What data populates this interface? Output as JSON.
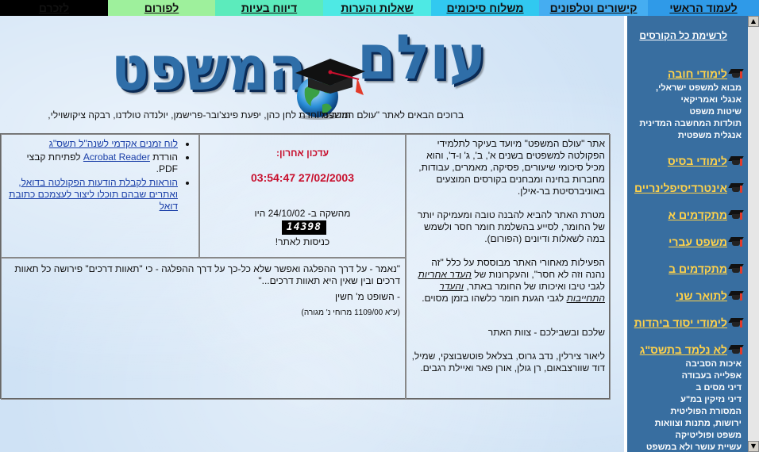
{
  "nav": {
    "zikhrono": "לזכרם",
    "forums": "לפורום",
    "reports": "דיווח בעיות",
    "qa": "שאלות והערות",
    "summaries": "משלוח סיכומים",
    "links": "קישורים וטלפונים",
    "home": "לעמוד הראשי"
  },
  "logo": {
    "word_right": "עולם",
    "word_left": "המשפט"
  },
  "welcome": "ברוכים הבאים לאתר \"עולם המשפט\"!",
  "thanks": "תודה מיוחדת לחן כהן, יפעת פינצ'ובר-פרישמן, יולנדה טולדנו, רבקה ציקושוילי,",
  "about": {
    "p1": "אתר \"עולם המשפט\" מיועד בעיקר לתלמידי הפקולטה למשפטים בשנים א', ב', ג' ו-ד', והוא מכיל סיכומי שיעורים, פסיקה, מאמרים, עבודות, מחברות בחינה ומבחנים בקורסים המוצעים באוניברסיטת בר-אילן.",
    "p2": "מטרת האתר להביא להבנה טובה ומעמיקה יותר של החומר, לסייע בהשלמת חומר חסר ולשמש במה לשאלות ודיונים (הפורום).",
    "p3a": "הפעילות מאחורי האתר מבוססת על כלל \"זה נהנה וזה לא חסר\", והעקרונות של",
    "p3b": "העדר אחריות",
    "p3c": "לגבי טיבו ואיכותו של החומר באתר,",
    "p3d": "והעדר התחייבות",
    "p3e": "לגבי הגעת חומר כלשהו בזמן מסוים.",
    "p4": "שלכם ובשבילכם - צוות האתר",
    "p5": "ליאור צירלין, נדב גרוס, בצלאל פוטשבוצקי, שמיל, דוד שוורצבאום, רן גולן, אורן פאר ואיילת רגבים."
  },
  "update": {
    "title": "עדכון אחרון:",
    "date": "03:54:47 27/02/2003",
    "relaunch": "מהשקה ב- 24/10/02 היו",
    "counter": "14398",
    "counter_label": "כניסות לאתר!"
  },
  "links": {
    "item1": "לוח זמנים אקדמי לשנה\"ל תשס\"ג",
    "item2_pre": "הורדת",
    "item2_link": "Acrobat Reader",
    "item2_post": "לפתיחת קבצי PDF.",
    "item3": "הוראות לקבלת הודעות הפקולטה בדואל, ואתרים שבהם תוכלו ליצור לעצמכם כתובת דואל"
  },
  "quote": {
    "text": "\"נאמר - על דרך ההפלגה ואפשר שלא כל-כך על דרך ההפלגה - כי \"תאוות דרכים\" פירושה כל תאוות דרכים ובין שאין היא תאוות דרכים...\"",
    "author": "- השופט מ' חשין",
    "source": "(ע\"א 1109/00 מרוחי נ' מגורה)"
  },
  "sidebar": {
    "course_list": "לרשימת כל הקורסים",
    "cats": [
      {
        "label": "לימודי חובה"
      },
      {
        "label": "לימודי בסיס"
      },
      {
        "label": "אינטרדיסיפלינריים"
      },
      {
        "label": "מתקדמים א"
      },
      {
        "label": "משפט עברי"
      },
      {
        "label": "מתקדמים ב"
      },
      {
        "label": "לתואר שני"
      },
      {
        "label": "לימודי יסוד ביהדות"
      },
      {
        "label": "לא נלמד בתשס\"ג"
      }
    ],
    "chova_subs": [
      "מבוא למשפט ישראלי,",
      "אנגלי ואמריקאי",
      "שיטות משפט",
      "תולדות המחשבה המדינית",
      "אנגלית משפטית"
    ],
    "notlearned_subs": [
      "איכות הסביבה",
      "אפלייה בעבודה",
      "דיני מסים ב",
      "דיני נזיקין במ\"ע",
      "המסורת הפוליטית",
      "ירושות, מתנות וצוואות",
      "משפט ופוליטיקה",
      "עשיית עושר ולא במשפט"
    ]
  },
  "colors": {
    "nav_home": "#2f9ae8",
    "nav_links": "#45adf1",
    "nav_summaries": "#31c9f0",
    "nav_qa": "#4ee9e4",
    "nav_reports": "#5cebbc",
    "nav_forums": "#9ef09c",
    "nav_zikhrono": "#000000",
    "sidebar_bg": "#386ea0",
    "sidebar_link": "#ffd24a",
    "accent_red": "#c8102e",
    "logo_blue": "#2f6ea8"
  }
}
